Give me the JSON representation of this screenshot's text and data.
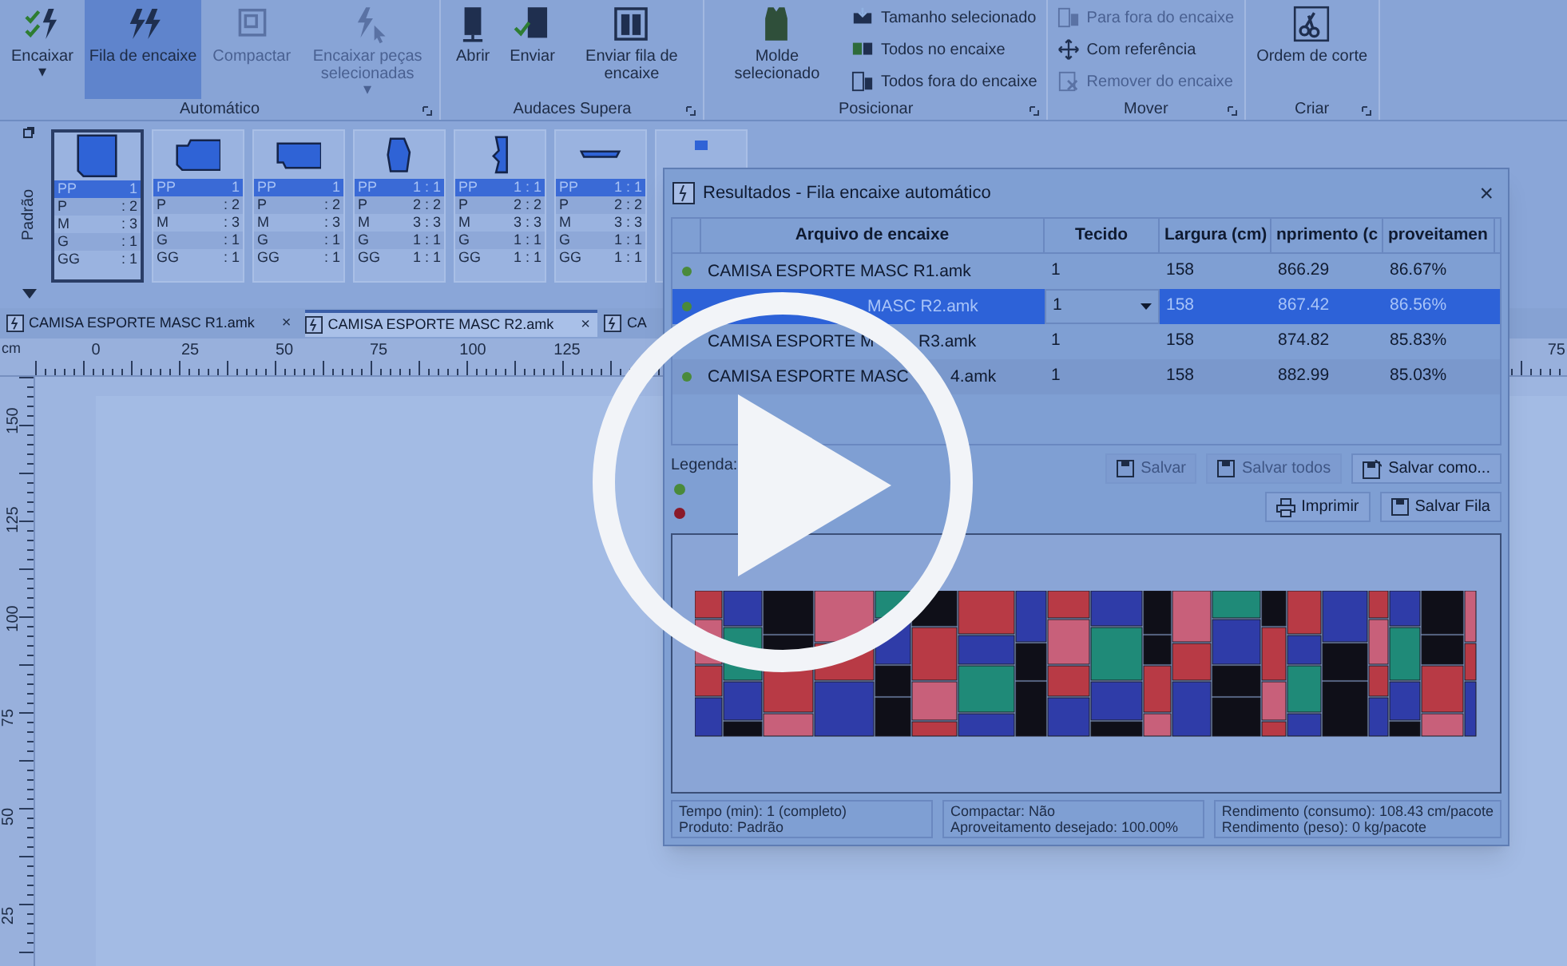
{
  "ribbon": {
    "groups": [
      {
        "label": "Automático",
        "buttons": [
          {
            "kind": "large",
            "label": "Encaixar",
            "dropdown": "▾",
            "selected": false,
            "disabled": false
          },
          {
            "kind": "large",
            "label": "Fila de encaixe",
            "selected": true,
            "disabled": false
          },
          {
            "kind": "large",
            "label": "Compactar",
            "selected": false,
            "disabled": true
          },
          {
            "kind": "large",
            "label": "Encaixar peças selecionadas",
            "dropdown": "▾",
            "selected": false,
            "disabled": true
          }
        ]
      },
      {
        "label": "Audaces Supera",
        "buttons": [
          {
            "kind": "large",
            "label": "Abrir",
            "selected": false,
            "disabled": false
          },
          {
            "kind": "large",
            "label": "Enviar",
            "selected": false,
            "disabled": false
          },
          {
            "kind": "large",
            "label": "Enviar fila de encaixe",
            "selected": false,
            "disabled": false
          }
        ]
      },
      {
        "label": "Posicionar",
        "buttons": [
          {
            "kind": "large",
            "label": "Molde selecionado",
            "selected": false,
            "disabled": false
          },
          {
            "kind": "small",
            "label": "Tamanho selecionado",
            "selected": false,
            "disabled": false
          },
          {
            "kind": "small",
            "label": "Todos no encaixe",
            "selected": false,
            "disabled": false
          },
          {
            "kind": "small",
            "label": "Todos fora do encaixe",
            "selected": false,
            "disabled": false
          }
        ]
      },
      {
        "label": "Mover",
        "buttons": [
          {
            "kind": "small",
            "label": "Para fora do encaixe",
            "selected": false,
            "disabled": true
          },
          {
            "kind": "small",
            "label": "Com referência",
            "selected": false,
            "disabled": false
          },
          {
            "kind": "small",
            "label": "Remover do encaixe",
            "selected": false,
            "disabled": true
          }
        ]
      },
      {
        "label": "Criar",
        "buttons": [
          {
            "kind": "large",
            "label": "Ordem de corte",
            "selected": false,
            "disabled": false
          }
        ]
      }
    ]
  },
  "pieces": {
    "side_label": "Padrão",
    "cards": [
      {
        "selected": true,
        "sizes": [
          {
            "size": "PP",
            "qty": "1",
            "selected": true
          },
          {
            "size": "P",
            "qty": ": 2",
            "selected": false
          },
          {
            "size": "M",
            "qty": ": 3",
            "selected": false
          },
          {
            "size": "G",
            "qty": ": 1",
            "selected": false
          },
          {
            "size": "GG",
            "qty": ": 1",
            "selected": false
          }
        ]
      },
      {
        "selected": false,
        "sizes": [
          {
            "size": "PP",
            "qty": "1",
            "selected": true
          },
          {
            "size": "P",
            "qty": ": 2",
            "selected": false
          },
          {
            "size": "M",
            "qty": ": 3",
            "selected": false
          },
          {
            "size": "G",
            "qty": ": 1",
            "selected": false
          },
          {
            "size": "GG",
            "qty": ": 1",
            "selected": false
          }
        ]
      },
      {
        "selected": false,
        "sizes": [
          {
            "size": "PP",
            "qty": "1",
            "selected": true
          },
          {
            "size": "P",
            "qty": ": 2",
            "selected": false
          },
          {
            "size": "M",
            "qty": ": 3",
            "selected": false
          },
          {
            "size": "G",
            "qty": ": 1",
            "selected": false
          },
          {
            "size": "GG",
            "qty": ": 1",
            "selected": false
          }
        ]
      },
      {
        "selected": false,
        "sizes": [
          {
            "size": "PP",
            "qty": "1 : 1",
            "selected": true
          },
          {
            "size": "P",
            "qty": "2 : 2",
            "selected": false
          },
          {
            "size": "M",
            "qty": "3 : 3",
            "selected": false
          },
          {
            "size": "G",
            "qty": "1 : 1",
            "selected": false
          },
          {
            "size": "GG",
            "qty": "1 : 1",
            "selected": false
          }
        ]
      },
      {
        "selected": false,
        "sizes": [
          {
            "size": "PP",
            "qty": "1 : 1",
            "selected": true
          },
          {
            "size": "P",
            "qty": "2 : 2",
            "selected": false
          },
          {
            "size": "M",
            "qty": "3 : 3",
            "selected": false
          },
          {
            "size": "G",
            "qty": "1 : 1",
            "selected": false
          },
          {
            "size": "GG",
            "qty": "1 : 1",
            "selected": false
          }
        ]
      },
      {
        "selected": false,
        "sizes": [
          {
            "size": "PP",
            "qty": "1 : 1",
            "selected": true
          },
          {
            "size": "P",
            "qty": "2 : 2",
            "selected": false
          },
          {
            "size": "M",
            "qty": "3 : 3",
            "selected": false
          },
          {
            "size": "G",
            "qty": "1 : 1",
            "selected": false
          },
          {
            "size": "GG",
            "qty": "1 : 1",
            "selected": false
          }
        ]
      }
    ]
  },
  "doc_tabs": [
    {
      "label": "CAMISA ESPORTE MASC R1.amk",
      "close": "×",
      "selected": false
    },
    {
      "label": "CAMISA ESPORTE MASC R2.amk",
      "close": "×",
      "selected": true
    },
    {
      "label": "CA",
      "selected": false
    }
  ],
  "ruler": {
    "unit": "cm",
    "top_labels": [
      "0",
      "25",
      "50",
      "75",
      "100",
      "125"
    ],
    "top_right_label": "75",
    "left_labels": [
      "150",
      "125",
      "100",
      "75",
      "50",
      "25"
    ]
  },
  "dialog": {
    "title": "Resultados - Fila encaixe automático",
    "close": "×",
    "table": {
      "columns": [
        "Arquivo de encaixe",
        "Tecido",
        "Largura (cm)",
        "nprimento (c",
        "proveitamen"
      ],
      "rows": [
        {
          "color": "#4a8a3a",
          "selected": false,
          "cells": [
            "CAMISA ESPORTE MASC R1.amk",
            "1",
            "158",
            "866.29",
            "86.67%"
          ]
        },
        {
          "color": "#4a8a3a",
          "selected": true,
          "cells": [
            "MASC R2.amk",
            "1",
            "158",
            "867.42",
            "86.56%"
          ]
        },
        {
          "selected": false,
          "cells": [
            "CAMISA ESPORTE M",
            "1",
            "158",
            "874.82",
            "85.83%"
          ],
          "name_tail": "R3.amk"
        },
        {
          "color": "#4a8a3a",
          "selected": false,
          "cells": [
            "CAMISA ESPORTE MASC",
            "1",
            "158",
            "882.99",
            "85.03%"
          ],
          "name_tail": "4.amk"
        }
      ]
    },
    "legend": {
      "title": "Legenda:",
      "dots": [
        {
          "color": "#4a8a3a"
        },
        {
          "color": "#8a1a2a"
        }
      ]
    },
    "buttons": [
      {
        "label": "Salvar",
        "disabled": true
      },
      {
        "label": "Salvar todos",
        "disabled": true
      },
      {
        "label": "Salvar como...",
        "disabled": false
      },
      {
        "label": "Imprimir",
        "disabled": false
      },
      {
        "label": "Salvar Fila",
        "disabled": false
      }
    ],
    "status": [
      [
        "Tempo (min): 1 (completo)",
        "Produto: Padrão"
      ],
      [
        "Compactar: Não",
        "Aproveitamento desejado: 100.00%"
      ],
      [
        "Rendimento (consumo): 108.43 cm/pacote",
        "Rendimento (peso): 0 kg/pacote"
      ]
    ]
  }
}
